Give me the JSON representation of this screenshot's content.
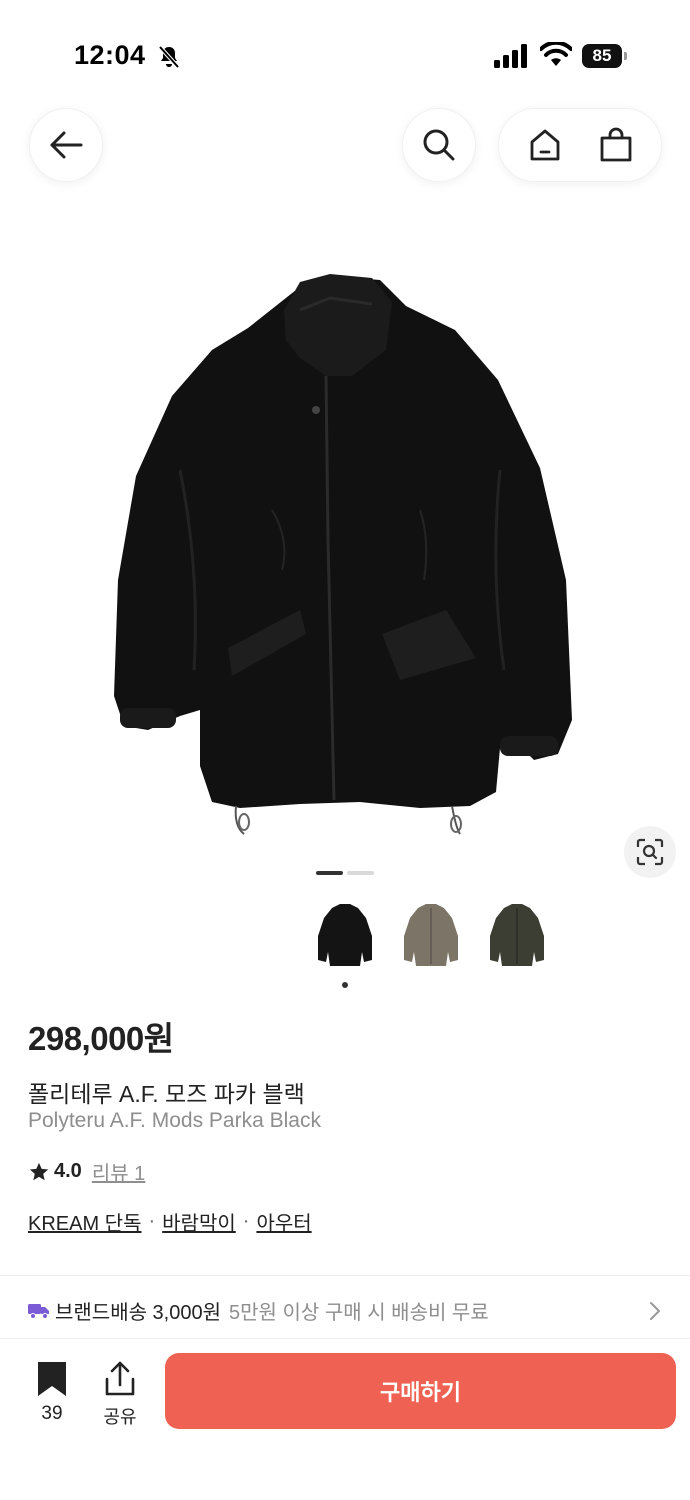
{
  "status_bar": {
    "time": "12:04",
    "battery": "85"
  },
  "nav": {
    "icons": [
      "back-arrow-icon",
      "search-icon",
      "home-icon",
      "shopping-bag-icon"
    ]
  },
  "gallery": {
    "page_current": 1,
    "page_total": 2,
    "thumbnails": [
      {
        "color_name": "black",
        "color": "#141414"
      },
      {
        "color_name": "khaki",
        "color": "#7d7468"
      },
      {
        "color_name": "olive",
        "color": "#3c3d33"
      }
    ],
    "selected_thumbnail": 0
  },
  "product": {
    "price": "298,000원",
    "name_ko": "폴리테루 A.F. 모즈 파카 블랙",
    "name_en": "Polyteru A.F. Mods Parka Black",
    "rating": "4.0",
    "review_label": "리뷰 1",
    "tags": [
      "KREAM 단독",
      "바람막이",
      "아우터"
    ],
    "tag_separator": "·"
  },
  "delivery": {
    "main": "브랜드배송 3,000원",
    "sub": "5만원 이상 구매 시 배송비 무료"
  },
  "bottom_bar": {
    "bookmark_count": "39",
    "share_label": "공유",
    "buy_label": "구매하기"
  },
  "colors": {
    "accent": "#ef6253",
    "truck_icon": "#7b5cd6",
    "text_primary": "#222222",
    "text_secondary": "#8e8e8e"
  }
}
